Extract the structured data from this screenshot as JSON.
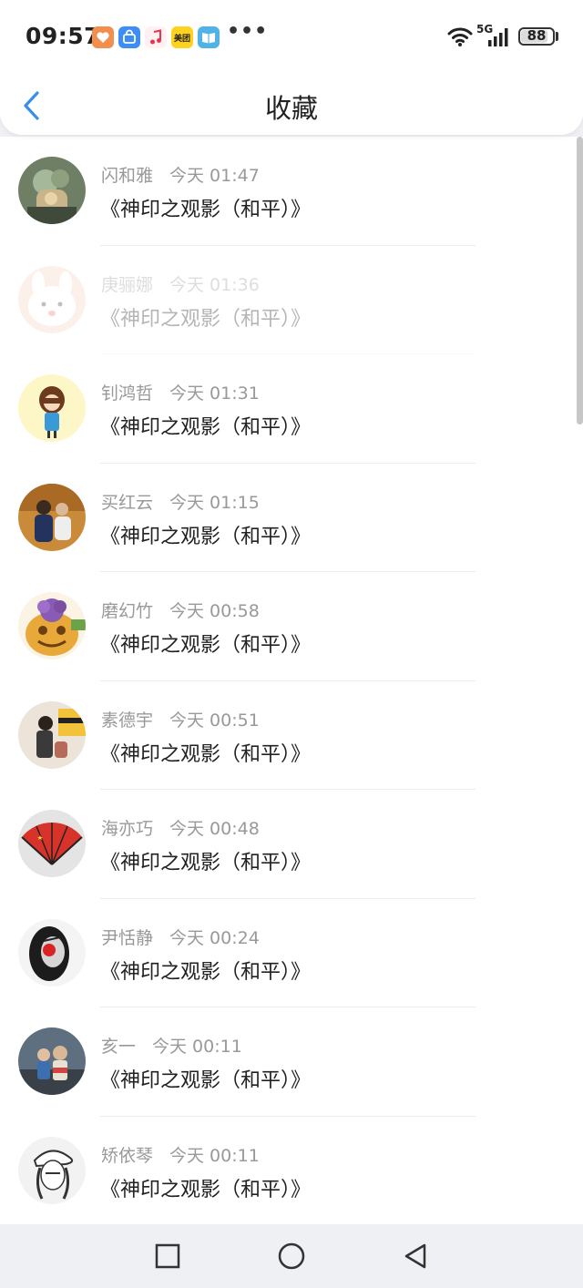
{
  "status_bar": {
    "time": "09:57",
    "more": "•••",
    "network": "5G",
    "battery": "88",
    "battery_level": 0.88,
    "app_icons": [
      {
        "name": "heart-app-icon",
        "color": "#f28f4e"
      },
      {
        "name": "shopping-bag-app-icon",
        "color": "#3d8df5"
      },
      {
        "name": "music-note-app-icon",
        "color": "#ffffff"
      },
      {
        "name": "meituan-app-icon",
        "label": "美团",
        "color": "#ffd21d"
      },
      {
        "name": "book-app-icon",
        "color": "#4fb3e8"
      }
    ]
  },
  "header": {
    "title": "收藏",
    "back_icon": "chevron-left-icon",
    "accent": "#3a8ee6"
  },
  "favorites": [
    {
      "name": "闪和雅",
      "time": "今天 01:47",
      "title": "《神印之观影（和平）》",
      "faded": false
    },
    {
      "name": "庚骊娜",
      "time": "今天 01:36",
      "title": "《神印之观影（和平）》",
      "faded": true
    },
    {
      "name": "钊鸿哲",
      "time": "今天 01:31",
      "title": "《神印之观影（和平）》",
      "faded": false
    },
    {
      "name": "买红云",
      "time": "今天 01:15",
      "title": "《神印之观影（和平）》",
      "faded": false
    },
    {
      "name": "磨幻竹",
      "time": "今天 00:58",
      "title": "《神印之观影（和平）》",
      "faded": false
    },
    {
      "name": "素德宇",
      "time": "今天 00:51",
      "title": "《神印之观影（和平）》",
      "faded": false
    },
    {
      "name": "海亦巧",
      "time": "今天 00:48",
      "title": "《神印之观影（和平）》",
      "faded": false
    },
    {
      "name": "尹恬静",
      "time": "今天 00:24",
      "title": "《神印之观影（和平）》",
      "faded": false
    },
    {
      "name": "亥一",
      "time": "今天 00:11",
      "title": "《神印之观影（和平）》",
      "faded": false
    },
    {
      "name": "矫依琴",
      "time": "今天 00:11",
      "title": "《神印之观影（和平）》",
      "faded": false
    }
  ],
  "nav_bar": {
    "recents_icon": "square-icon",
    "home_icon": "circle-icon",
    "back_icon": "triangle-back-icon"
  }
}
